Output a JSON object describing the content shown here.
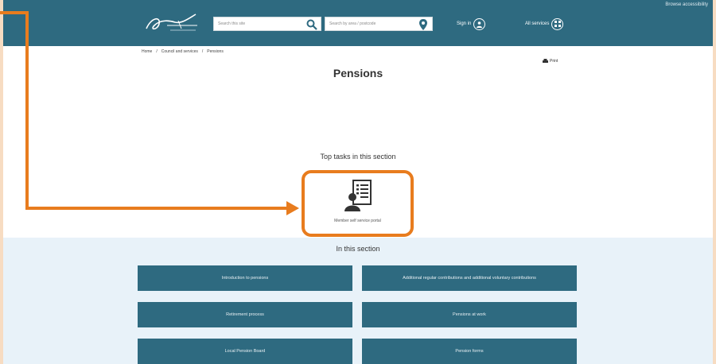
{
  "header": {
    "accessibility_link": "Browse accessibility",
    "site_search": {
      "placeholder": "Search this site"
    },
    "postcode_search": {
      "placeholder": "Search by area / postcode"
    },
    "sign_in": "Sign in",
    "all_services": "All services"
  },
  "breadcrumb": [
    "Home",
    "Council and services",
    "Pensions"
  ],
  "print_label": "Print",
  "page_title": "Pensions",
  "top_tasks": {
    "heading": "Top tasks in this section",
    "items": [
      {
        "label": "Member self service portal",
        "icon": "member-document-icon"
      }
    ]
  },
  "in_this_section": {
    "heading": "In this section",
    "links": [
      "Introduction to pensions",
      "Additional regular contributions and additional voluntary contributions",
      "Retirement process",
      "Pensions at work",
      "Local Pension Board",
      "Pension forms"
    ]
  },
  "colors": {
    "header": "#2e6a80",
    "tile": "#2e6a80",
    "annotation": "#e87c1e",
    "section_band": "#e8f2f9"
  }
}
